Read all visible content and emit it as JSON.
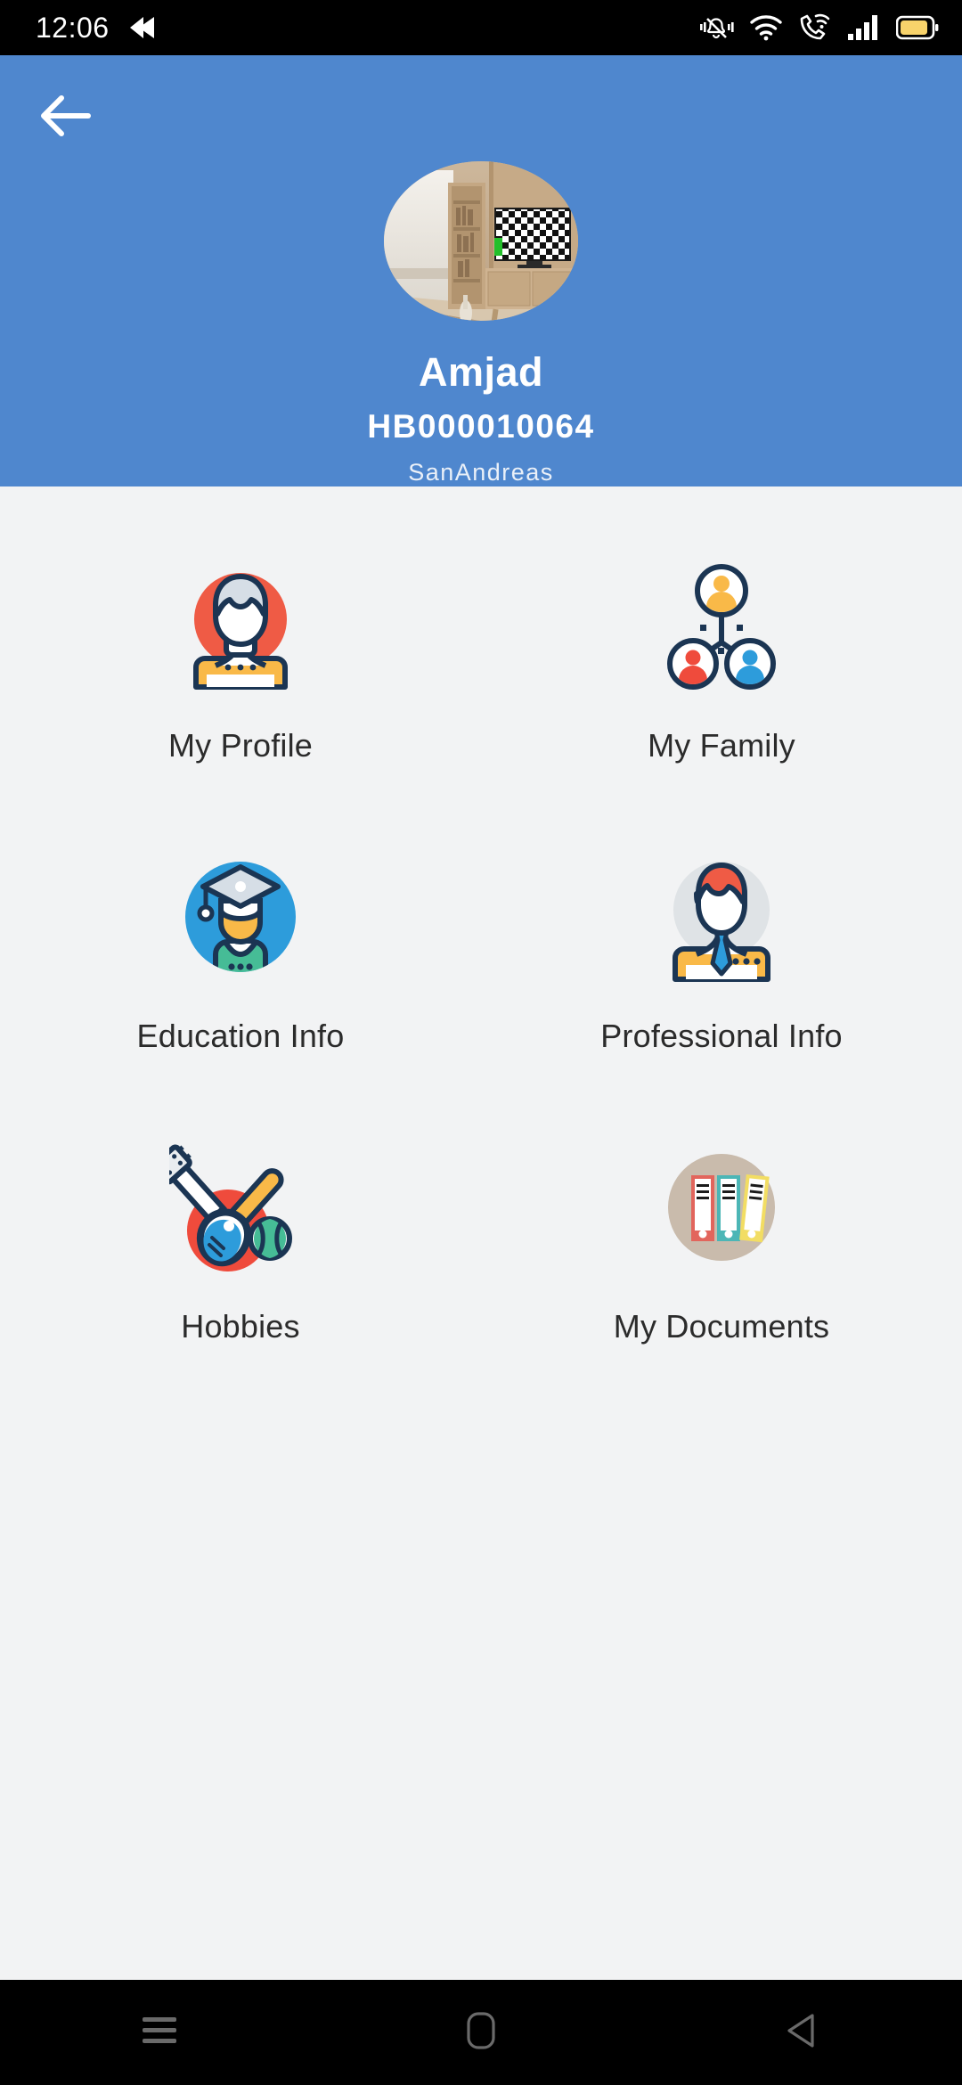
{
  "statusbar": {
    "time": "12:06",
    "icons": [
      {
        "name": "media-back-icon",
        "side": "left"
      },
      {
        "name": "vibrate-mute-icon",
        "side": "right"
      },
      {
        "name": "wifi-icon",
        "side": "right"
      },
      {
        "name": "vowifi-call-icon",
        "side": "right"
      },
      {
        "name": "signal-bars-icon",
        "side": "right"
      },
      {
        "name": "battery-icon",
        "side": "right"
      }
    ],
    "battery_color": "#F8D36B"
  },
  "header": {
    "background_color": "#4F87CE",
    "back_icon": "back-arrow-icon",
    "avatar_alt": "living-room-photo",
    "name": "Amjad",
    "id": "HB000010064",
    "location": "SanAndreas"
  },
  "page": {
    "background_color": "#F2F3F4"
  },
  "menu": {
    "items": [
      {
        "label": "My Profile",
        "icon": "user-avatar-icon"
      },
      {
        "label": "My Family",
        "icon": "family-tree-icon"
      },
      {
        "label": "Education Info",
        "icon": "graduate-icon"
      },
      {
        "label": "Professional Info",
        "icon": "businessman-icon"
      },
      {
        "label": "Hobbies",
        "icon": "guitar-bat-ball-icon"
      },
      {
        "label": "My Documents",
        "icon": "binders-icon"
      }
    ]
  },
  "navbar": {
    "buttons": [
      {
        "name": "recents-button",
        "icon": "hamburger-icon"
      },
      {
        "name": "home-button",
        "icon": "rounded-square-icon"
      },
      {
        "name": "back-button",
        "icon": "triangle-left-icon"
      }
    ]
  }
}
